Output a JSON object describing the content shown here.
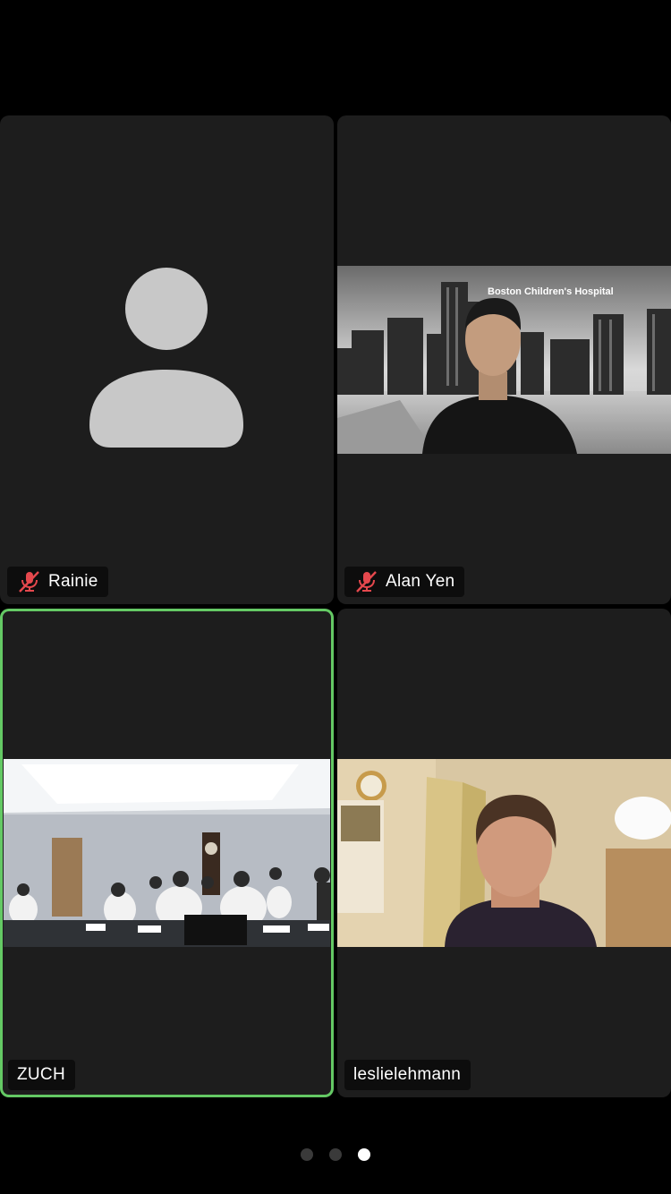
{
  "participants": [
    {
      "name": "Rainie",
      "muted": true,
      "video": "avatar-placeholder"
    },
    {
      "name": "Alan Yen",
      "muted": true,
      "video": "city-skyline-background",
      "background_text": "Boston Children's Hospital"
    },
    {
      "name": "ZUCH",
      "muted": false,
      "video": "conference-room",
      "active_speaker": true
    },
    {
      "name": "leslielehmann",
      "muted": false,
      "video": "home-kitchen"
    }
  ],
  "pagination": {
    "pages": 3,
    "current": 3
  },
  "colors": {
    "tile_background": "#1d1d1d",
    "active_speaker_border": "#64c964",
    "muted_icon": "#e5484d",
    "avatar_silhouette": "#c8c8c8"
  }
}
